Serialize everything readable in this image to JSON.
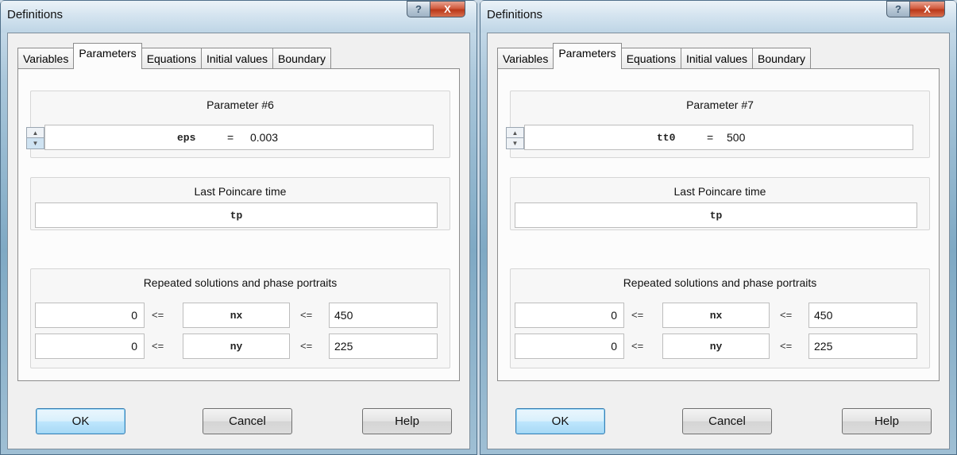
{
  "dialogs": [
    {
      "title": "Definitions",
      "tabs": [
        "Variables",
        "Parameters",
        "Equations",
        "Initial values",
        "Boundary"
      ],
      "active_tab": "Parameters",
      "parameter_group": {
        "title": "Parameter #6",
        "name": "eps",
        "equals": "=",
        "value": "0.003"
      },
      "poincare_group": {
        "title": "Last Poincare time",
        "value": "tp"
      },
      "repeated_group": {
        "title": "Repeated solutions and phase portraits",
        "rows": [
          {
            "min": "0",
            "op1": "<=",
            "name": "nx",
            "op2": "<=",
            "max": "450"
          },
          {
            "min": "0",
            "op1": "<=",
            "name": "ny",
            "op2": "<=",
            "max": "225"
          }
        ]
      },
      "buttons": {
        "ok": "OK",
        "cancel": "Cancel",
        "help": "Help"
      }
    },
    {
      "title": "Definitions",
      "tabs": [
        "Variables",
        "Parameters",
        "Equations",
        "Initial values",
        "Boundary"
      ],
      "active_tab": "Parameters",
      "parameter_group": {
        "title": "Parameter #7",
        "name": "tt0",
        "equals": "=",
        "value": "500"
      },
      "poincare_group": {
        "title": "Last Poincare time",
        "value": "tp"
      },
      "repeated_group": {
        "title": "Repeated solutions and phase portraits",
        "rows": [
          {
            "min": "0",
            "op1": "<=",
            "name": "nx",
            "op2": "<=",
            "max": "450"
          },
          {
            "min": "0",
            "op1": "<=",
            "name": "ny",
            "op2": "<=",
            "max": "225"
          }
        ]
      },
      "buttons": {
        "ok": "OK",
        "cancel": "Cancel",
        "help": "Help"
      }
    }
  ],
  "caption_buttons": {
    "help_glyph": "?",
    "close_glyph": "X"
  },
  "icons": {
    "help": "question-mark-icon",
    "close": "close-icon",
    "spin_up": "triangle-up-icon",
    "spin_down": "triangle-down-icon"
  },
  "colors": {
    "frame_glass": "#a9c6da",
    "client_bg": "#f0f0f0",
    "close_button": "#d15c3f",
    "default_button_border": "#3c7fb1"
  }
}
